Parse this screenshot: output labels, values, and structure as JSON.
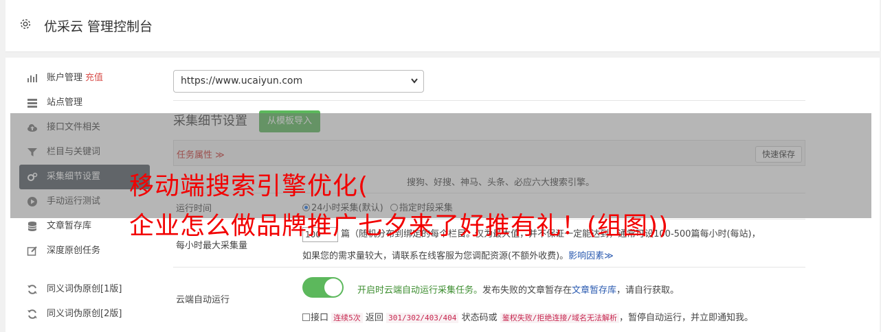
{
  "header": {
    "title": "优采云 管理控制台"
  },
  "sidebar": {
    "items": [
      {
        "label": "账户管理",
        "badge": "充值"
      },
      {
        "label": "站点管理"
      },
      {
        "label": "接口文件相关"
      },
      {
        "label": "栏目与关键词"
      },
      {
        "label": "采集细节设置"
      },
      {
        "label": "手动运行测试"
      },
      {
        "label": "文章暂存库"
      },
      {
        "label": "深度原创任务"
      },
      {
        "label": "同义词伪原创[1版]"
      },
      {
        "label": "同义词伪原创[2版]"
      }
    ]
  },
  "main": {
    "site_select": "https://www.ucaiyun.com",
    "section_title": "采集细节设置",
    "template_button": "从模板导入",
    "task_tab": "任务属性",
    "quick_save": "快速保存",
    "engine_row": {
      "text": "搜狗、好搜、神马、头条、必应六大搜索引擎。"
    },
    "run_time": {
      "label": "运行时间",
      "opt1": "24小时采集(默认)",
      "opt2": "指定时段采集"
    },
    "max_per_hour": {
      "label": "每小时最大采集量",
      "value": "100",
      "line1": "篇（随机分布到绑定的每个栏目。仅为最大值，并不保证一定能达到，通常可设100-500篇每小时(每站)，",
      "line2": "如果您的需求量较大，请联系在线客服为您调配资源(不额外收费)。",
      "link": "影响因素"
    },
    "cloud_run": {
      "label": "云端自动运行",
      "desc_green": "开启时云端自动运行采集任务。",
      "desc_text": "发布失败的文章暂存在",
      "desc_link": "文章暂存库",
      "desc_end": "，请自行获取。",
      "check_prefix": "接口",
      "code1": "连续5次",
      "mid1": "返回",
      "code2": "301/302/403/404",
      "mid2": "状态码或",
      "code3": "鉴权失败/拒绝连接/域名无法解析",
      "tail": "，暂停自动运行，并立即通知我。"
    }
  },
  "watermark": {
    "line1": "移动端搜索引擎优化(",
    "line2": "企业怎么做品牌推广七夕来了好推有礼！(组图))"
  }
}
